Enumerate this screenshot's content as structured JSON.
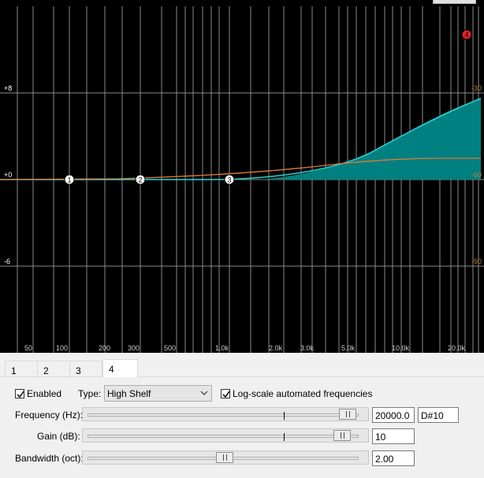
{
  "graph": {
    "left_db_labels": [
      "+8",
      "+0",
      "-6"
    ],
    "right_db_labels": [
      "-30",
      "-60",
      "-90"
    ],
    "freq_labels": [
      "50",
      "100",
      "200",
      "300",
      "500",
      "1.0k",
      "2.0k",
      "3.0k",
      "5.0k",
      "10.0k",
      "20.0k"
    ],
    "node_labels": [
      "1",
      "2",
      "3",
      "4"
    ],
    "colors": {
      "background": "#000000",
      "grid": "#6e6e6e",
      "response_curve": "#2ad4d4",
      "response_fill": "#008080",
      "band_curve": "#e07a3a",
      "right_labels": "#b5892a",
      "active_node": "#e8202a"
    }
  },
  "tabs": [
    {
      "label": "1"
    },
    {
      "label": "2"
    },
    {
      "label": "3"
    },
    {
      "label": "4"
    }
  ],
  "controls": {
    "enabled_label": "Enabled",
    "enabled_checked": true,
    "type_label": "Type:",
    "type_value": "High Shelf",
    "log_scale_label": "Log-scale automated frequencies",
    "log_scale_checked": true,
    "frequency_label": "Frequency (Hz):",
    "frequency_value": "20000.0",
    "frequency_note": "D#10",
    "gain_label": "Gain (dB):",
    "gain_value": "10",
    "bandwidth_label": "Bandwidth (oct):",
    "bandwidth_value": "2.00"
  }
}
